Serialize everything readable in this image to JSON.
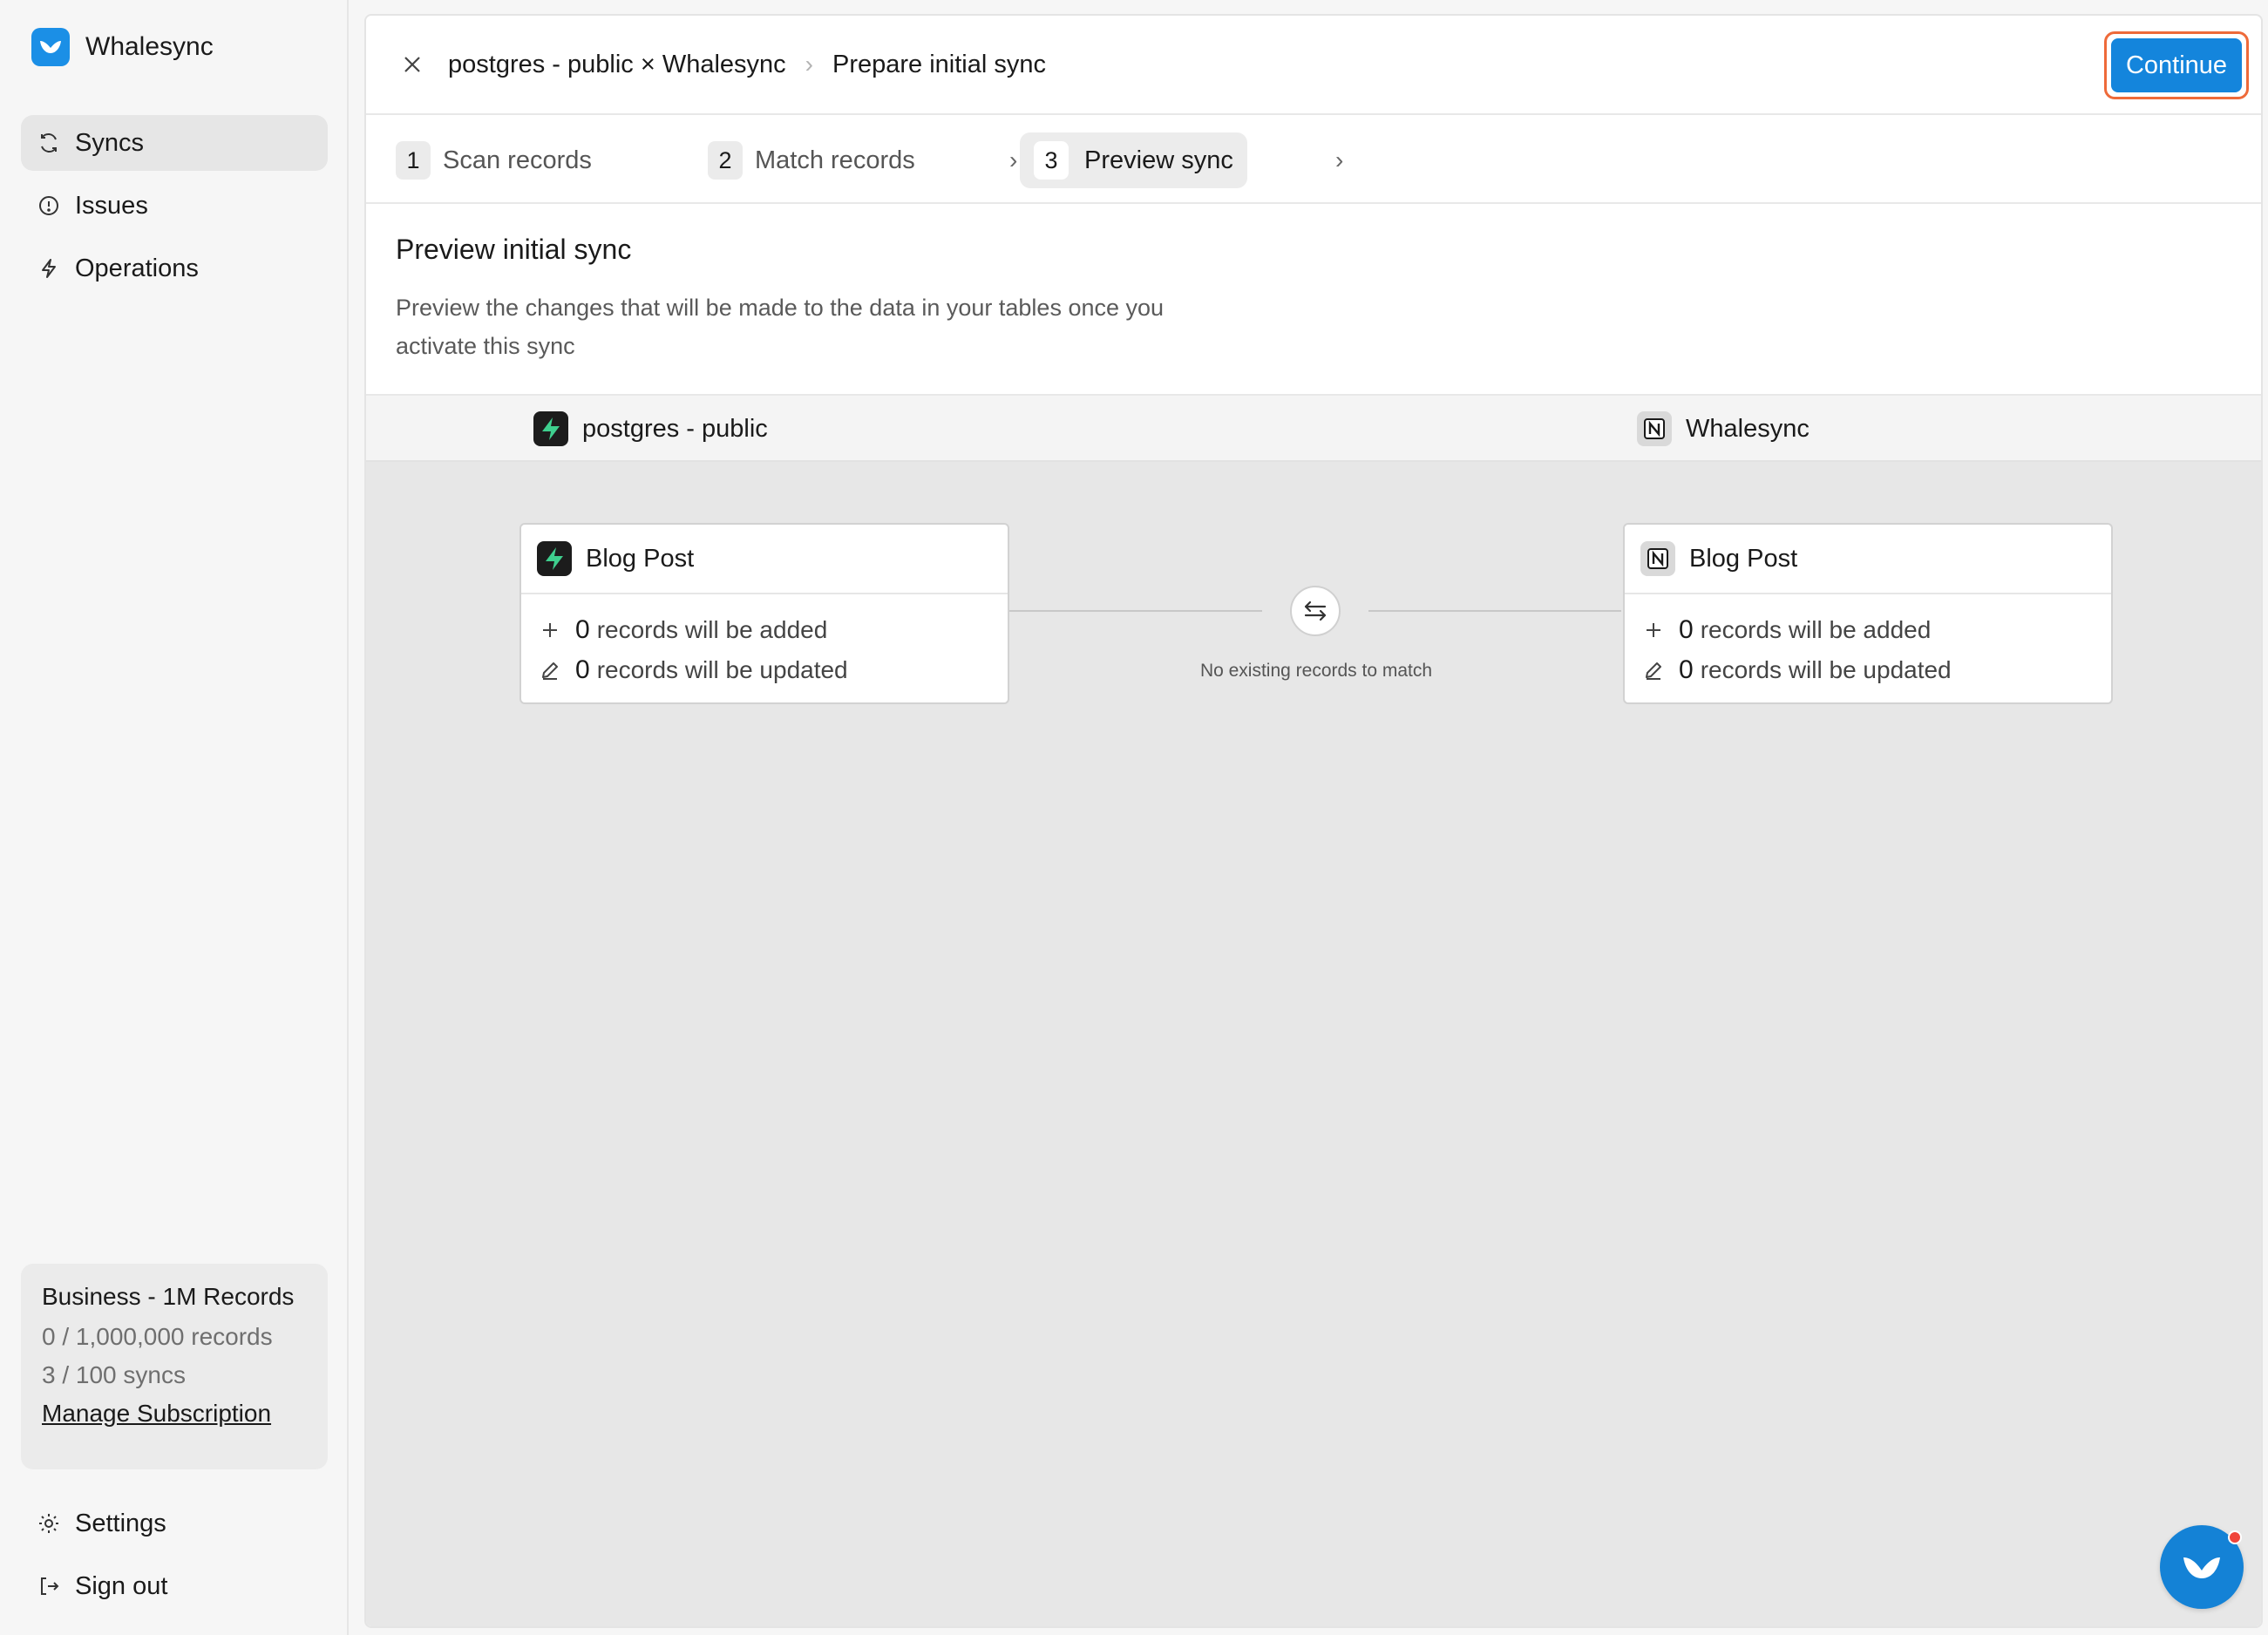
{
  "brand": {
    "name": "Whalesync",
    "accent": "#1b8fe6"
  },
  "sidebar": {
    "items": [
      {
        "label": "Syncs",
        "icon": "sync-icon",
        "active": true
      },
      {
        "label": "Issues",
        "icon": "alert-circle-icon"
      },
      {
        "label": "Operations",
        "icon": "lightning-icon"
      }
    ],
    "plan": {
      "title": "Business - 1M Records",
      "records": "0 / 1,000,000 records",
      "syncs": "3 / 100 syncs",
      "manage_label": "Manage Subscription"
    },
    "bottom": [
      {
        "label": "Settings",
        "icon": "gear-icon"
      },
      {
        "label": "Sign out",
        "icon": "sign-out-icon"
      }
    ]
  },
  "header": {
    "breadcrumb_sync": "postgres - public × Whalesync",
    "breadcrumb_sep": "›",
    "breadcrumb_page": "Prepare initial sync",
    "continue_label": "Continue"
  },
  "steps": [
    {
      "num": "1",
      "label": "Scan records"
    },
    {
      "num": "2",
      "label": "Match records"
    },
    {
      "num": "3",
      "label": "Preview sync",
      "active": true
    }
  ],
  "step_separator": "›",
  "intro": {
    "title": "Preview initial sync",
    "description": "Preview the changes that will be made to the data in your tables once you activate this sync"
  },
  "sources": {
    "left": {
      "name": "postgres - public",
      "icon": "supabase-icon"
    },
    "right": {
      "name": "Whalesync",
      "icon": "notion-icon"
    }
  },
  "cards": {
    "left": {
      "title": "Blog Post",
      "added_count": "0",
      "added_text": "records will be added",
      "updated_count": "0",
      "updated_text": "records will be updated"
    },
    "right": {
      "title": "Blog Post",
      "added_count": "0",
      "added_text": "records will be added",
      "updated_count": "0",
      "updated_text": "records will be updated"
    }
  },
  "match_note": "No existing records to match",
  "colors": {
    "primary": "#1485dc",
    "highlight_border": "#ee6a3a",
    "notification": "#f0443a"
  }
}
